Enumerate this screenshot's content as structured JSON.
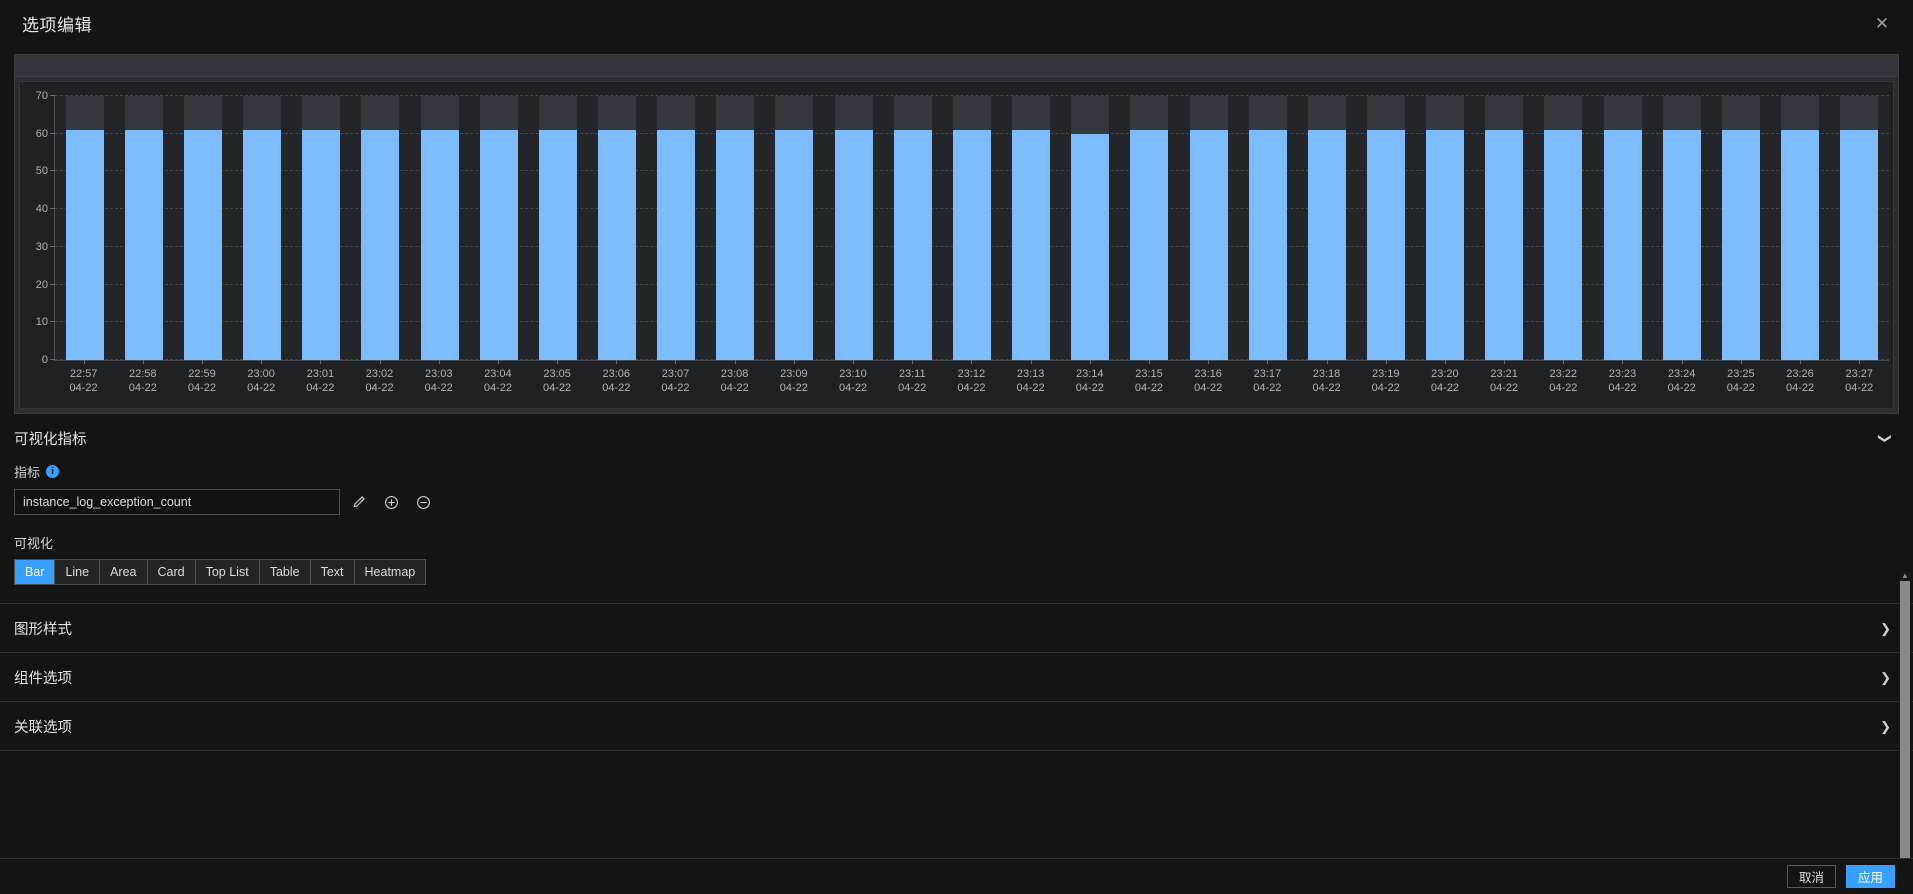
{
  "dialog": {
    "title": "选项编辑",
    "close_icon": "close-icon"
  },
  "chart_data": {
    "type": "bar",
    "title": "",
    "xlabel": "",
    "ylabel": "",
    "ylim": [
      0,
      70
    ],
    "yticks": [
      0,
      10,
      20,
      30,
      40,
      50,
      60,
      70
    ],
    "grid": true,
    "legend": null,
    "bar_color": "#7cbcff",
    "track_color": "#35383c",
    "categories": [
      "22:57\n04-22",
      "22:58\n04-22",
      "22:59\n04-22",
      "23:00\n04-22",
      "23:01\n04-22",
      "23:02\n04-22",
      "23:03\n04-22",
      "23:04\n04-22",
      "23:05\n04-22",
      "23:06\n04-22",
      "23:07\n04-22",
      "23:08\n04-22",
      "23:09\n04-22",
      "23:10\n04-22",
      "23:11\n04-22",
      "23:12\n04-22",
      "23:13\n04-22",
      "23:14\n04-22",
      "23:15\n04-22",
      "23:16\n04-22",
      "23:17\n04-22",
      "23:18\n04-22",
      "23:19\n04-22",
      "23:20\n04-22",
      "23:21\n04-22",
      "23:22\n04-22",
      "23:23\n04-22",
      "23:24\n04-22",
      "23:25\n04-22",
      "23:26\n04-22",
      "23:27\n04-22"
    ],
    "tick_times": [
      "22:57",
      "22:58",
      "22:59",
      "23:00",
      "23:01",
      "23:02",
      "23:03",
      "23:04",
      "23:05",
      "23:06",
      "23:07",
      "23:08",
      "23:09",
      "23:10",
      "23:11",
      "23:12",
      "23:13",
      "23:14",
      "23:15",
      "23:16",
      "23:17",
      "23:18",
      "23:19",
      "23:20",
      "23:21",
      "23:22",
      "23:23",
      "23:24",
      "23:25",
      "23:26",
      "23:27"
    ],
    "tick_date": "04-22",
    "values": [
      61,
      61,
      61,
      61,
      61,
      61,
      61,
      61,
      61,
      61,
      61,
      61,
      61,
      61,
      61,
      61,
      61,
      60,
      61,
      61,
      61,
      61,
      61,
      61,
      61,
      61,
      61,
      61,
      61,
      61,
      61
    ]
  },
  "sections": {
    "metrics": {
      "title": "可视化指标",
      "expanded": true,
      "chevron": "chevron-down-icon",
      "metric_label": "指标",
      "metric_info_icon": "info-icon",
      "metric_value": "instance_log_exception_count",
      "metric_placeholder": "instance_log_exception_count",
      "edit_icon": "pencil-icon",
      "add_icon": "plus-circle-icon",
      "remove_icon": "minus-circle-icon",
      "viz_label": "可视化",
      "viz_options": [
        "Bar",
        "Line",
        "Area",
        "Card",
        "Top List",
        "Table",
        "Text",
        "Heatmap"
      ],
      "viz_selected": "Bar"
    },
    "style": {
      "title": "图形样式",
      "chevron": "chevron-right-icon"
    },
    "component": {
      "title": "组件选项",
      "chevron": "chevron-right-icon"
    },
    "relation": {
      "title": "关联选项",
      "chevron": "chevron-right-icon"
    }
  },
  "footer": {
    "cancel_label": "取消",
    "apply_label": "应用",
    "accent_color": "#3aa0ff"
  },
  "scrollbar": {
    "up_arrow_icon": "caret-up-icon"
  }
}
